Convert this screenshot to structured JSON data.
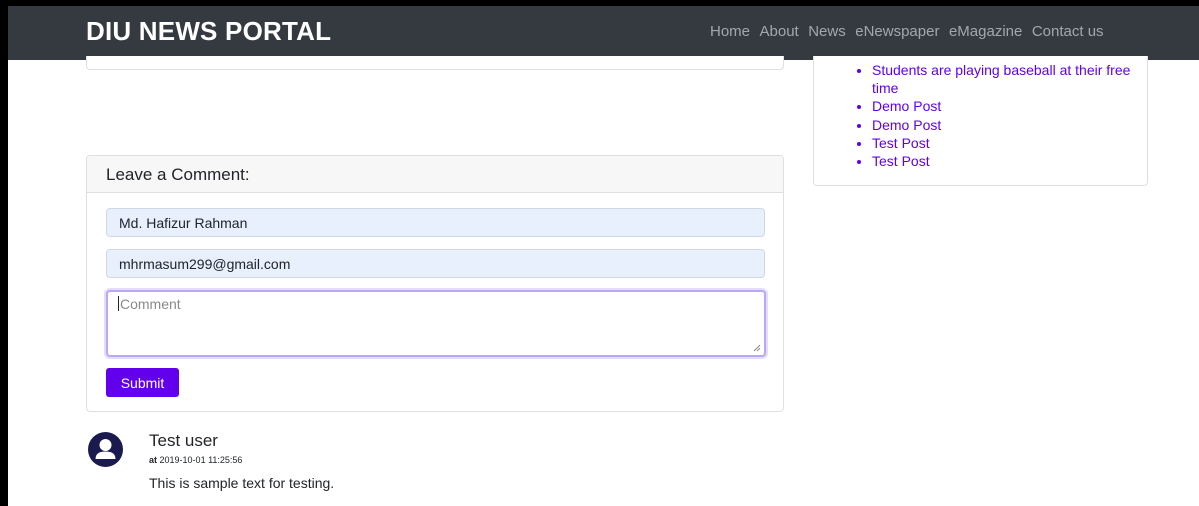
{
  "navbar": {
    "brand": "DIU NEWS PORTAL",
    "links": [
      "Home",
      "About",
      "News",
      "eNewspaper",
      "eMagazine",
      "Contact us"
    ]
  },
  "sidebar": {
    "recent_posts": [
      "Students are playing baseball at their free time",
      "Demo Post",
      "Demo Post",
      "Test Post",
      "Test Post"
    ]
  },
  "comment_form": {
    "title": "Leave a Comment:",
    "name_value": "Md. Hafizur Rahman",
    "email_value": "mhrmasum299@gmail.com",
    "comment_placeholder": "Comment",
    "submit_label": "Submit"
  },
  "comments": [
    {
      "author": "Test user",
      "at_label": "at",
      "timestamp": "2019-10-01 11:25:56",
      "body": "This is sample text for testing."
    }
  ],
  "colors": {
    "navbar_bg": "#343a40",
    "accent": "#6200ee",
    "autofill_bg": "#e8f0fe",
    "avatar_bg": "#1a1a4e"
  },
  "icons": {
    "avatar": "user-avatar-icon",
    "resize": "resize-grip-icon"
  }
}
